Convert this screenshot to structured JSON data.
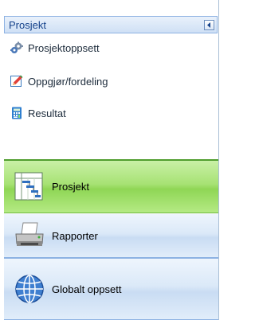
{
  "panel": {
    "title": "Prosjekt"
  },
  "tasks": [
    {
      "label": "Prosjektoppsett",
      "icon": "gears-icon"
    },
    {
      "label": "Oppgjør/fordeling",
      "icon": "edit-pencil-icon"
    },
    {
      "label": "Resultat",
      "icon": "calculator-icon"
    }
  ],
  "nav": [
    {
      "label": "Prosjekt",
      "icon": "gantt-chart-icon",
      "selected": true
    },
    {
      "label": "Rapporter",
      "icon": "printer-icon",
      "selected": false
    },
    {
      "label": "Globalt oppsett",
      "icon": "globe-icon",
      "selected": false
    }
  ],
  "colors": {
    "header_text": "#15428b",
    "selected_nav": "#a7e274",
    "nav_background": "#dbe9f8",
    "border": "#8db2e3"
  }
}
